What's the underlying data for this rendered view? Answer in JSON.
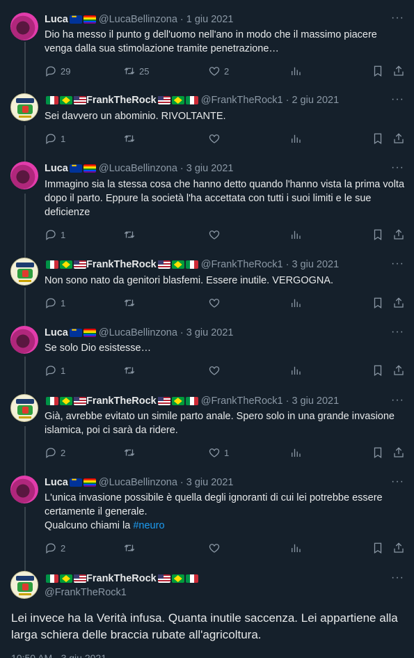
{
  "tweets": [
    {
      "name": "Luca",
      "handle": "@LucaBellinzona",
      "date": "1 giu 2021",
      "text": "Dio ha messo il punto g dell'uomo nell'ano in modo che il massimo piacere venga dalla sua stimolazione tramite penetrazione…",
      "replies": "29",
      "retweets": "25",
      "likes": "2"
    },
    {
      "name": "FrankTheRock",
      "handle": "@FrankTheRock1",
      "date": "2 giu 2021",
      "text": "Sei davvero un abominio. RIVOLTANTE.",
      "replies": "1",
      "retweets": "",
      "likes": ""
    },
    {
      "name": "Luca",
      "handle": "@LucaBellinzona",
      "date": "3 giu 2021",
      "text": "Immagino sia la stessa cosa che hanno detto quando l'hanno vista la prima volta dopo il parto. Eppure la società l'ha accettata con tutti i suoi limiti e le sue deficienze",
      "replies": "1",
      "retweets": "",
      "likes": ""
    },
    {
      "name": "FrankTheRock",
      "handle": "@FrankTheRock1",
      "date": "3 giu 2021",
      "text": "Non sono nato da genitori blasfemi. Essere inutile. VERGOGNA.",
      "replies": "1",
      "retweets": "",
      "likes": ""
    },
    {
      "name": "Luca",
      "handle": "@LucaBellinzona",
      "date": "3 giu 2021",
      "text": "Se solo Dio esistesse…",
      "replies": "1",
      "retweets": "",
      "likes": ""
    },
    {
      "name": "FrankTheRock",
      "handle": "@FrankTheRock1",
      "date": "3 giu 2021",
      "text": "Già, avrebbe evitato un simile parto anale. Spero solo in una grande invasione islamica, poi ci sarà da ridere.",
      "replies": "2",
      "retweets": "",
      "likes": "1"
    },
    {
      "name": "Luca",
      "handle": "@LucaBellinzona",
      "date": "3 giu 2021",
      "text": "L'unica invasione possibile è quella degli ignoranti di cui lei potrebbe essere certamente il generale.\nQualcuno chiami la",
      "hashtag": "#neuro",
      "replies": "2",
      "retweets": "",
      "likes": ""
    }
  ],
  "main_tweet": {
    "name": "FrankTheRock",
    "handle": "@FrankTheRock1",
    "text": "Lei invece ha la Verità infusa. Quanta inutile saccenza. Lei appartiene alla larga schiera delle braccia rubate all'agricoltura.",
    "timestamp": "10:50 AM · 3 giu 2021"
  },
  "date_separator": "·",
  "more_label": "···",
  "colors": {
    "background": "#15202b",
    "text": "#e7e9ea",
    "muted": "#8b98a5",
    "link": "#1d9bf0",
    "thread_line": "#38444d"
  },
  "icons": [
    "reply-icon",
    "retweet-icon",
    "like-icon",
    "views-icon",
    "bookmark-icon",
    "share-icon",
    "more-icon"
  ]
}
